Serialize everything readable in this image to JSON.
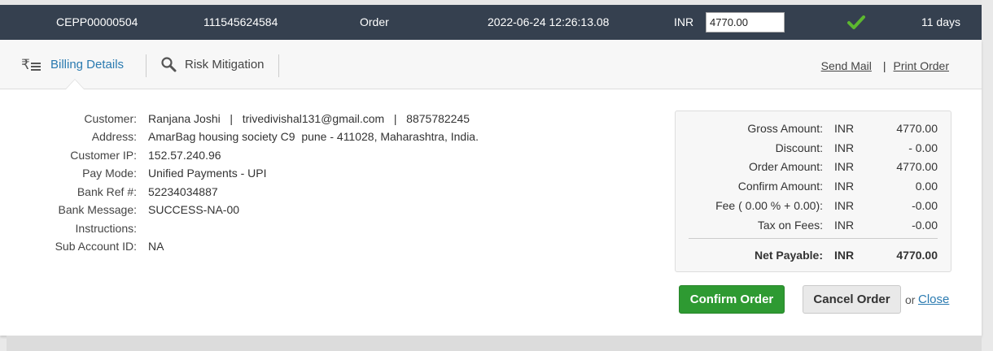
{
  "order_row": {
    "order_id": "CEPP00000504",
    "reference": "111545624584",
    "type": "Order",
    "datetime": "2022-06-24 12:26:13.08",
    "currency": "INR",
    "amount_value": "4770.00",
    "status_icon": "check-icon",
    "status_color": "#5cb82f",
    "age": "11 days"
  },
  "tabs": [
    {
      "label": "Billing Details",
      "icon": "rupee-list-icon",
      "active": true
    },
    {
      "label": "Risk Mitigation",
      "icon": "search-icon",
      "active": false
    }
  ],
  "links": {
    "send_mail": "Send Mail",
    "separator": "|",
    "print_order": "Print Order"
  },
  "details": [
    {
      "label": "Customer:",
      "value": "Ranjana Joshi   |   trivedivishal131@gmail.com   |   8875782245"
    },
    {
      "label": "Address:",
      "value": "AmarBag housing society C9  pune - 411028, Maharashtra, India."
    },
    {
      "label": "Customer IP:",
      "value": "152.57.240.96"
    },
    {
      "label": "Pay Mode:",
      "value": "Unified Payments - UPI"
    },
    {
      "label": "Bank Ref #:",
      "value": "52234034887"
    },
    {
      "label": "Bank Message:",
      "value": "SUCCESS-NA-00"
    },
    {
      "label": "Instructions:",
      "value": ""
    },
    {
      "label": "Sub Account ID:",
      "value": "NA"
    }
  ],
  "summary": [
    {
      "label": "Gross Amount:",
      "currency": "INR",
      "value": "4770.00"
    },
    {
      "label": "Discount:",
      "currency": "INR",
      "value": "- 0.00"
    },
    {
      "label": "Order Amount:",
      "currency": "INR",
      "value": "4770.00"
    },
    {
      "label": "Confirm Amount:",
      "currency": "INR",
      "value": "0.00"
    },
    {
      "label": "Fee ( 0.00 % + 0.00):",
      "currency": "INR",
      "value": "-0.00"
    },
    {
      "label": "Tax on Fees:",
      "currency": "INR",
      "value": "-0.00"
    }
  ],
  "net": {
    "label": "Net Payable:",
    "currency": "INR",
    "value": "4770.00"
  },
  "actions": {
    "confirm": "Confirm Order",
    "cancel": "Cancel Order",
    "or": "or",
    "close": "Close"
  },
  "colors": {
    "header_bg": "#35404f",
    "accent_blue": "#2a7ab0",
    "confirm_green": "#2e9a32"
  }
}
